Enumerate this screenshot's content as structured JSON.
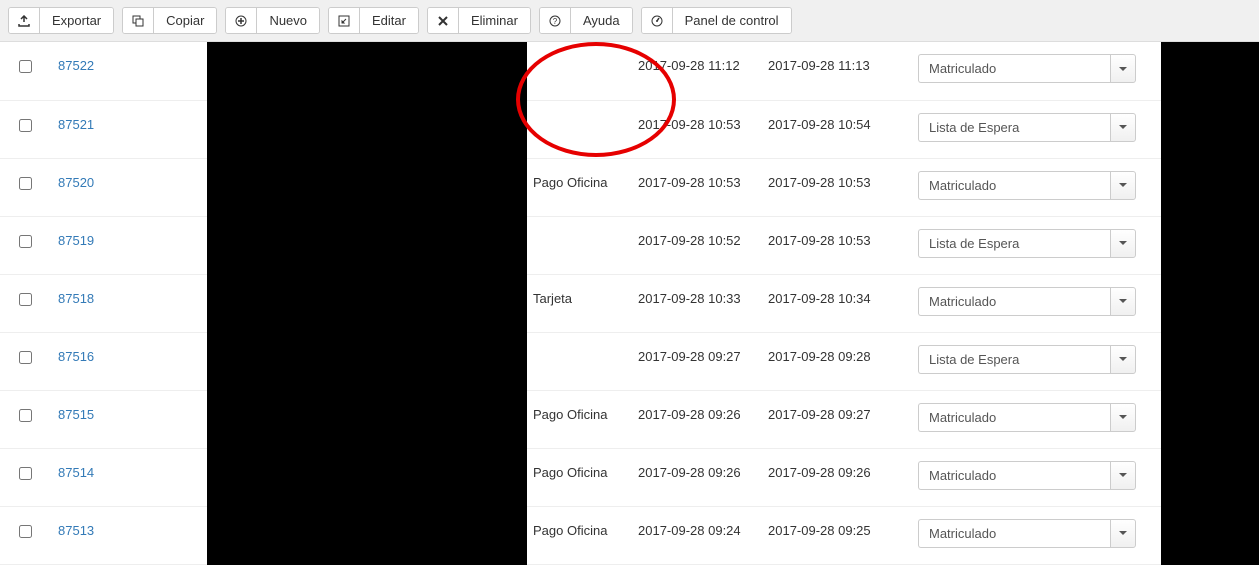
{
  "toolbar": {
    "export": "Exportar",
    "copy": "Copiar",
    "new": "Nuevo",
    "edit": "Editar",
    "delete": "Eliminar",
    "help": "Ayuda",
    "dashboard": "Panel de control"
  },
  "status_options": {
    "matriculado": "Matriculado",
    "lista_espera": "Lista de Espera"
  },
  "rows": [
    {
      "id": "87522",
      "pago": "",
      "d1": "2017-09-28 11:12",
      "d2": "2017-09-28 11:13",
      "status": "Matriculado"
    },
    {
      "id": "87521",
      "pago": "",
      "d1": "2017-09-28 10:53",
      "d2": "2017-09-28 10:54",
      "status": "Lista de Espera"
    },
    {
      "id": "87520",
      "pago": "Pago Oficina",
      "d1": "2017-09-28 10:53",
      "d2": "2017-09-28 10:53",
      "status": "Matriculado"
    },
    {
      "id": "87519",
      "pago": "",
      "d1": "2017-09-28 10:52",
      "d2": "2017-09-28 10:53",
      "status": "Lista de Espera"
    },
    {
      "id": "87518",
      "pago": "Tarjeta",
      "d1": "2017-09-28 10:33",
      "d2": "2017-09-28 10:34",
      "status": "Matriculado"
    },
    {
      "id": "87516",
      "pago": "",
      "d1": "2017-09-28 09:27",
      "d2": "2017-09-28 09:28",
      "status": "Lista de Espera"
    },
    {
      "id": "87515",
      "pago": "Pago Oficina",
      "d1": "2017-09-28 09:26",
      "d2": "2017-09-28 09:27",
      "status": "Matriculado"
    },
    {
      "id": "87514",
      "pago": "Pago Oficina",
      "d1": "2017-09-28 09:26",
      "d2": "2017-09-28 09:26",
      "status": "Matriculado"
    },
    {
      "id": "87513",
      "pago": "Pago Oficina",
      "d1": "2017-09-28 09:24",
      "d2": "2017-09-28 09:25",
      "status": "Matriculado"
    }
  ]
}
